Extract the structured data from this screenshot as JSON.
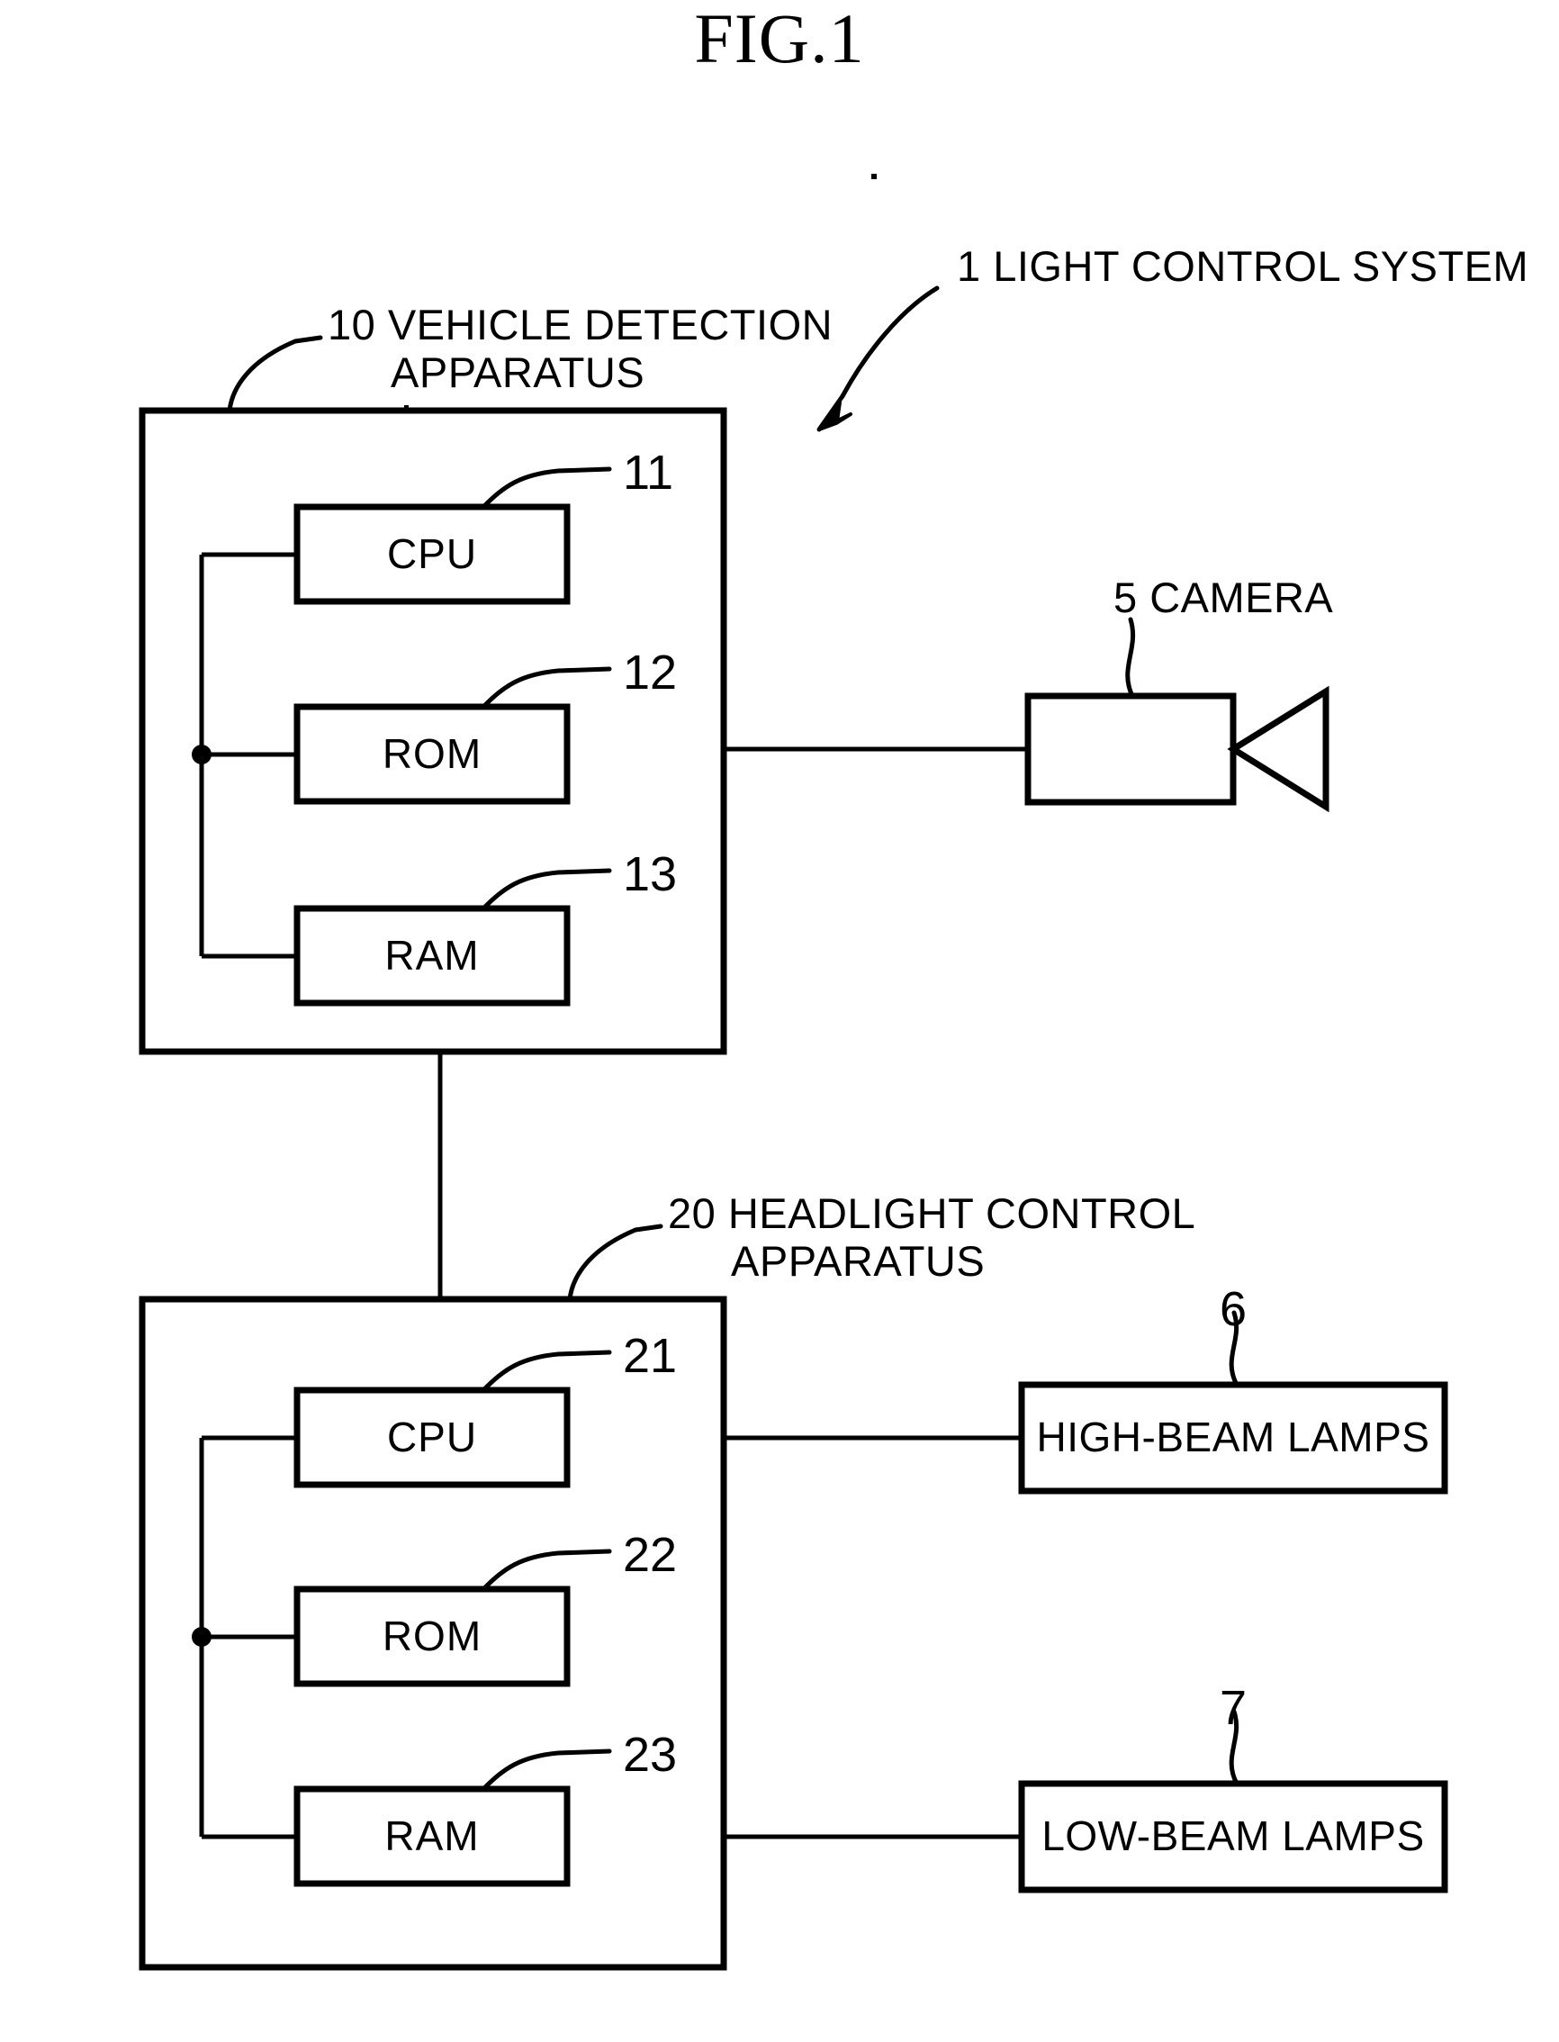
{
  "figure": {
    "title": "FIG.1",
    "type": "patent-block-diagram"
  },
  "system_callout": {
    "ref": "1",
    "label": "LIGHT CONTROL SYSTEM",
    "text": "1 LIGHT CONTROL SYSTEM"
  },
  "blocks": [
    {
      "id": "vehicle-detection-apparatus",
      "ref": "10",
      "label_line1": "10 VEHICLE DETECTION",
      "label_line2": "APPARATUS",
      "children": [
        {
          "ref": "11",
          "label": "CPU"
        },
        {
          "ref": "12",
          "label": "ROM"
        },
        {
          "ref": "13",
          "label": "RAM"
        }
      ]
    },
    {
      "id": "headlight-control-apparatus",
      "ref": "20",
      "label_line1": "20 HEADLIGHT CONTROL",
      "label_line2": "APPARATUS",
      "children": [
        {
          "ref": "21",
          "label": "CPU"
        },
        {
          "ref": "22",
          "label": "ROM"
        },
        {
          "ref": "23",
          "label": "RAM"
        }
      ]
    }
  ],
  "peripherals": [
    {
      "id": "camera",
      "ref": "5",
      "label": "CAMERA",
      "callout": "5 CAMERA",
      "shape": "box-with-lens-triangle"
    },
    {
      "id": "high-beam-lamps",
      "ref": "6",
      "label": "HIGH-BEAM LAMPS",
      "shape": "box"
    },
    {
      "id": "low-beam-lamps",
      "ref": "7",
      "label": "LOW-BEAM LAMPS",
      "shape": "box"
    }
  ],
  "units": {
    "upper_cpu": "CPU",
    "upper_rom": "ROM",
    "upper_ram": "RAM",
    "lower_cpu": "CPU",
    "lower_rom": "ROM",
    "lower_ram": "RAM"
  },
  "refs": {
    "system": "1",
    "camera": "5",
    "high_beam": "6",
    "low_beam": "7",
    "vehicle_detection": "10",
    "upper_cpu": "11",
    "upper_rom": "12",
    "upper_ram": "13",
    "headlight_control": "20",
    "lower_cpu": "21",
    "lower_rom": "22",
    "lower_ram": "23"
  },
  "colors": {
    "ink": "#000000",
    "paper": "#ffffff"
  }
}
